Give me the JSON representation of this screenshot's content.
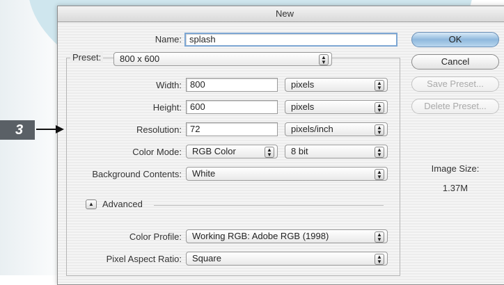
{
  "step": {
    "number": "3"
  },
  "window": {
    "title": "New"
  },
  "name": {
    "label": "Name:",
    "value": "splash"
  },
  "preset": {
    "label": "Preset:",
    "value": "800 x 600"
  },
  "width": {
    "label": "Width:",
    "value": "800",
    "unit": "pixels"
  },
  "height": {
    "label": "Height:",
    "value": "600",
    "unit": "pixels"
  },
  "resolution": {
    "label": "Resolution:",
    "value": "72",
    "unit": "pixels/inch"
  },
  "color_mode": {
    "label": "Color Mode:",
    "mode": "RGB Color",
    "depth": "8 bit"
  },
  "background": {
    "label": "Background Contents:",
    "value": "White"
  },
  "advanced": {
    "label": "Advanced"
  },
  "color_profile": {
    "label": "Color Profile:",
    "value": "Working RGB:  Adobe RGB (1998)"
  },
  "pixel_aspect": {
    "label": "Pixel Aspect Ratio:",
    "value": "Square"
  },
  "buttons": {
    "ok": "OK",
    "cancel": "Cancel",
    "save_preset": "Save Preset...",
    "delete_preset": "Delete Preset..."
  },
  "image_size": {
    "label": "Image Size:",
    "value": "1.37M"
  },
  "colors": {
    "callout_bg": "#5a6066",
    "ok_button": "#8fb9dd",
    "background_blob": "#cfe6ee"
  }
}
